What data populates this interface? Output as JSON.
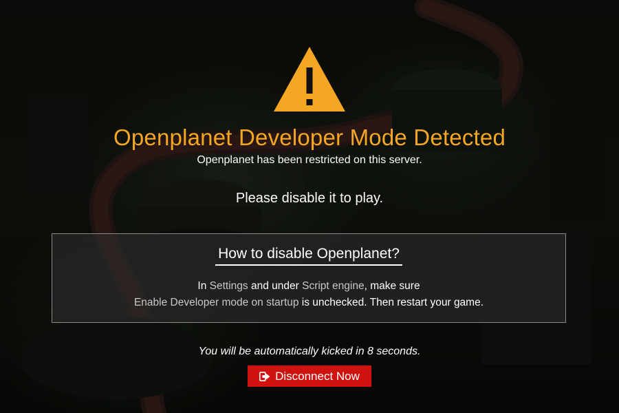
{
  "warning": {
    "icon": "warning-triangle-icon",
    "color": "#f5a623"
  },
  "dialog": {
    "title": "Openplanet Developer Mode Detected",
    "subtitle": "Openplanet has been restricted on this server.",
    "instruction": "Please disable it to play."
  },
  "help": {
    "heading": "How to disable Openplanet?",
    "line1": {
      "t1": "In ",
      "settings": "Settings",
      "t2": " and under ",
      "script_engine": "Script engine",
      "t3": ", make sure"
    },
    "line2": {
      "option": "Enable Developer mode on startup",
      "t1": " is unchecked. Then restart your game."
    }
  },
  "kick_notice": "You will be automatically kicked in 8 seconds.",
  "disconnect_button": {
    "label": "Disconnect Now",
    "icon": "sign-out-icon",
    "color": "#d0120f"
  },
  "colors": {
    "title": "#f5a623",
    "highlight": "#c8c8c8",
    "box_border": "#8a8a8a"
  }
}
